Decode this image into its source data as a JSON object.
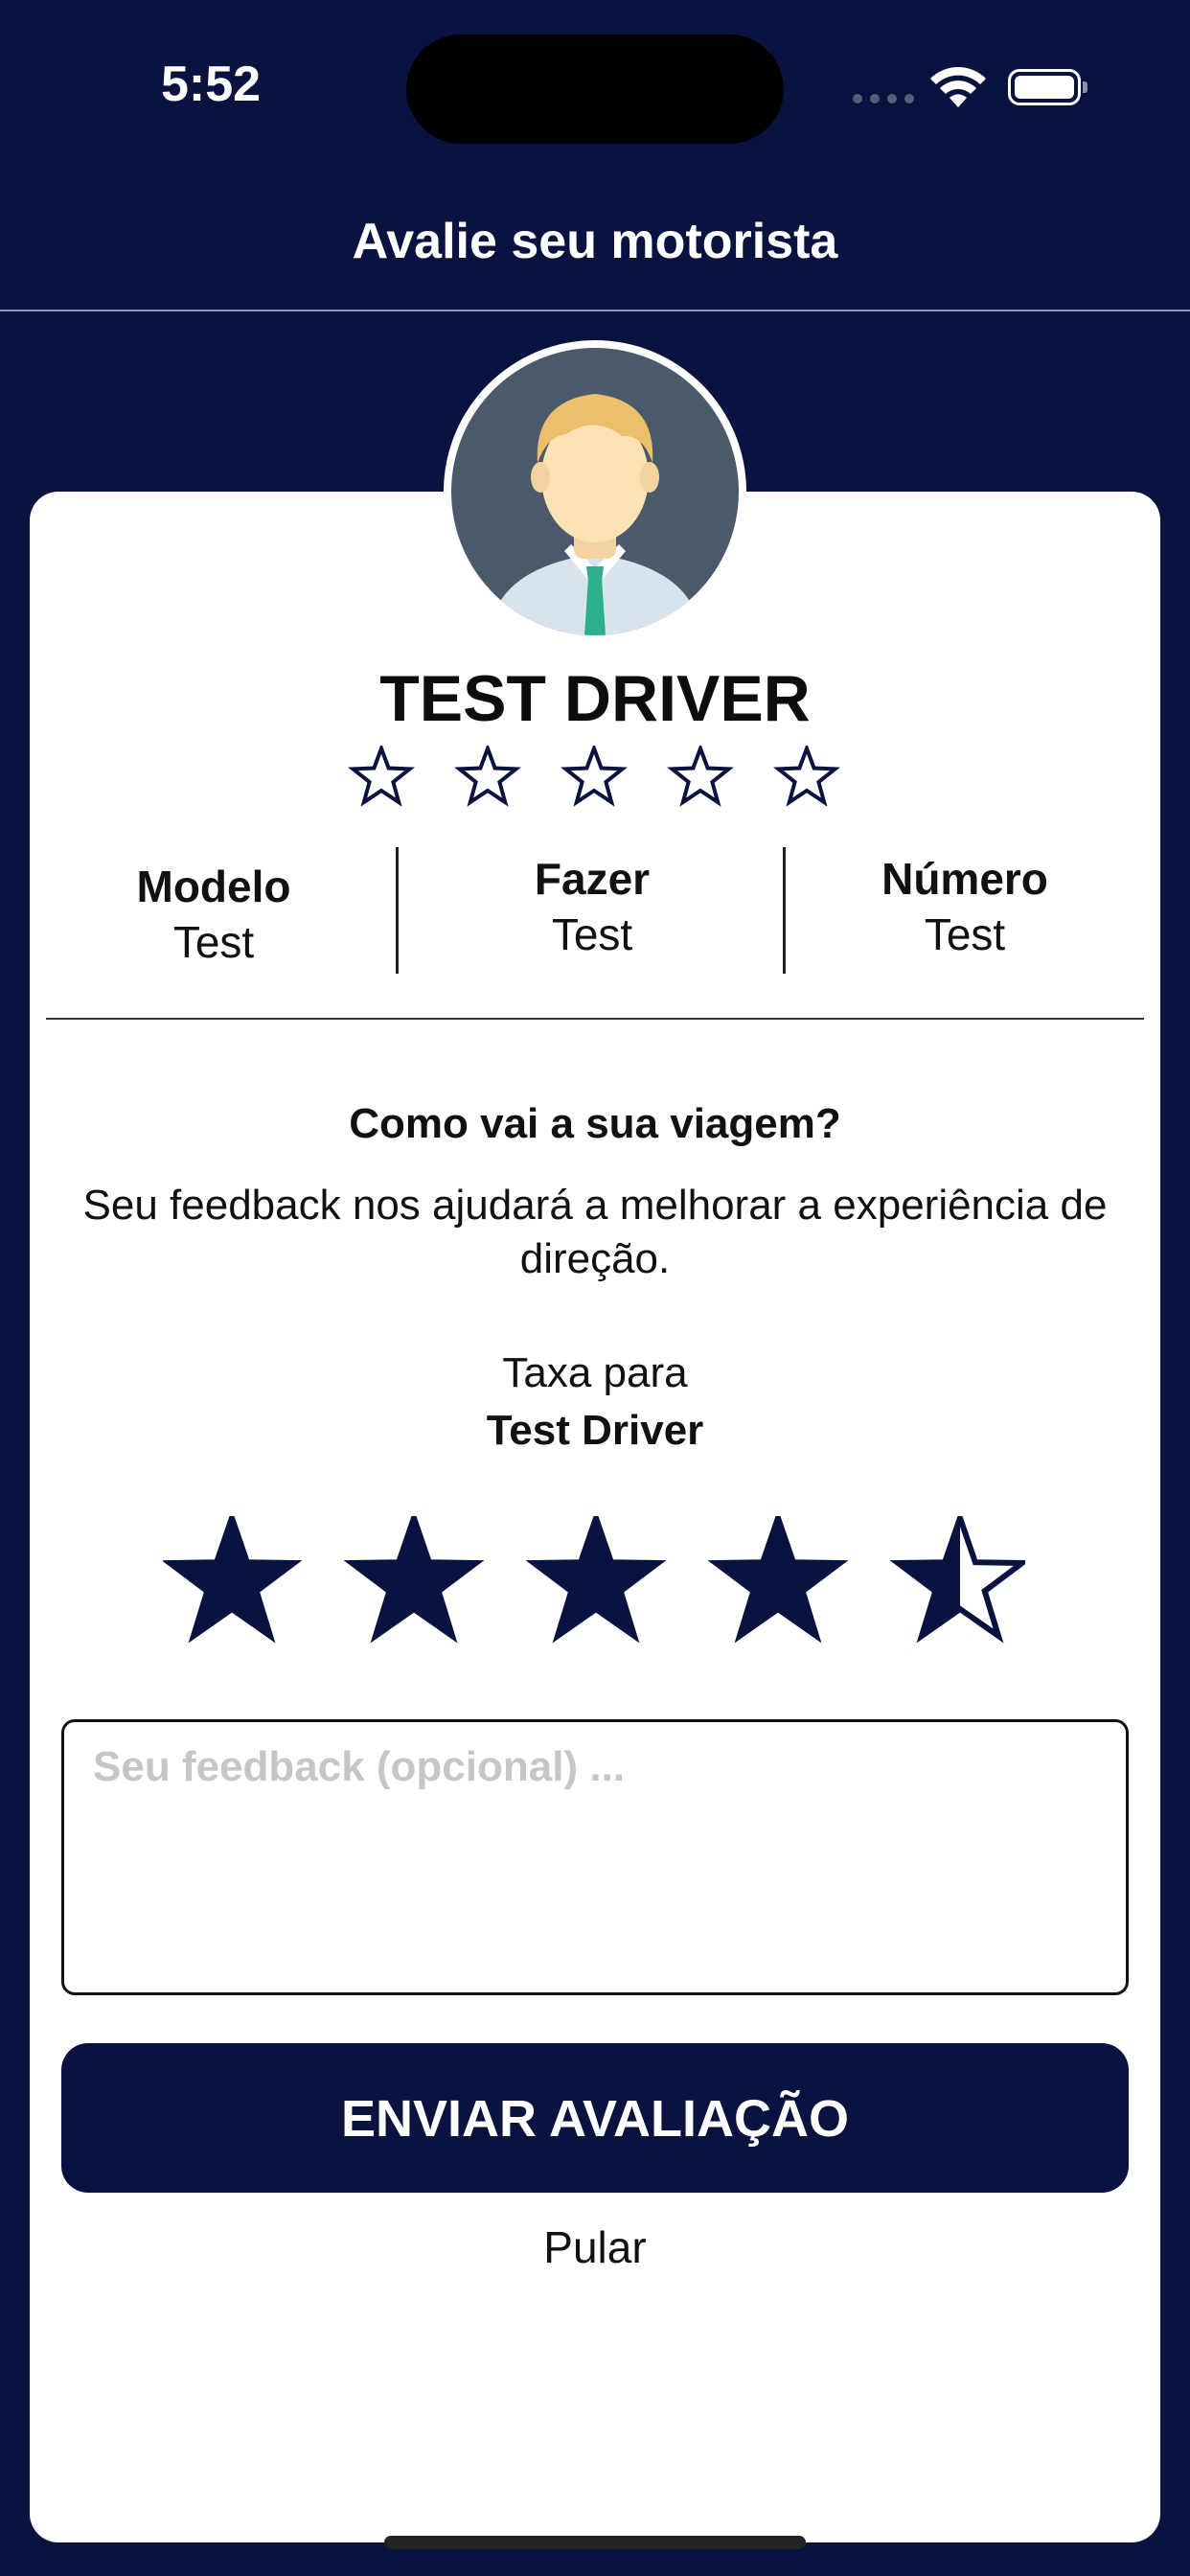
{
  "status_bar": {
    "time": "5:52"
  },
  "nav": {
    "title": "Avalie seu motorista"
  },
  "driver": {
    "name": "TEST DRIVER",
    "rating_stars": 5,
    "rating_value": 0
  },
  "vehicle": [
    {
      "label": "Modelo",
      "value": "Test"
    },
    {
      "label": "Fazer",
      "value": "Test"
    },
    {
      "label": "Número",
      "value": "Test"
    }
  ],
  "feedback": {
    "question": "Como vai a sua viagem?",
    "description": "Seu feedback nos ajudará a melhorar a experiência de direção.",
    "rate_for": "Taxa para",
    "rate_name": "Test Driver",
    "rating": 4.5,
    "max_rating": 5,
    "input_placeholder": "Seu feedback (opcional) ...",
    "input_value": ""
  },
  "actions": {
    "submit_label": "ENVIAR AVALIAÇÃO",
    "skip_label": "Pular"
  },
  "colors": {
    "background": "#0a1240",
    "star": "#0a1240",
    "card": "#ffffff"
  },
  "icons": {
    "avatar": "driver-avatar",
    "wifi": "wifi-icon",
    "battery": "battery-icon"
  }
}
